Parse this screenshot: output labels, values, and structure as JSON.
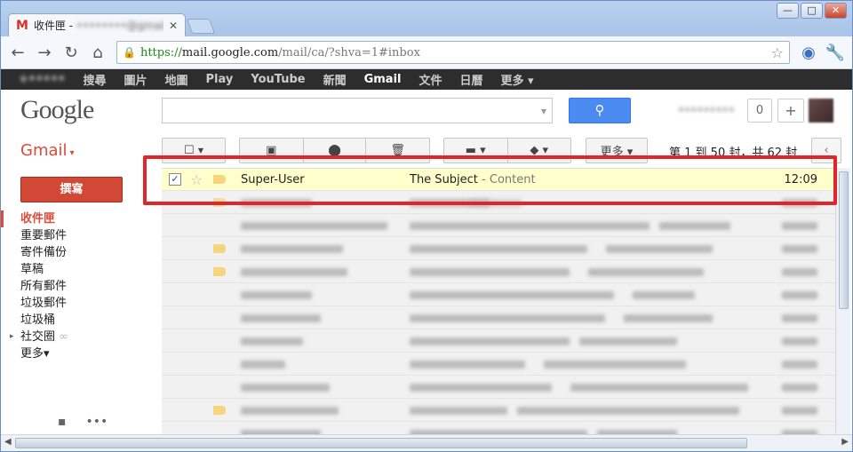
{
  "browser": {
    "tab_title": "收件匣",
    "tab_account": "••••••••@gmail.com",
    "tab_close": "✕",
    "window_buttons": [
      "—",
      "□",
      "✕"
    ],
    "url_scheme": "https://",
    "url_host": "mail.google.com",
    "url_path": "/mail/ca/?shva=1#inbox"
  },
  "gbar": {
    "items": [
      "+•••••",
      "搜尋",
      "圖片",
      "地圖",
      "Play",
      "YouTube",
      "新聞",
      "Gmail",
      "文件",
      "日曆",
      "更多 ▾"
    ]
  },
  "header": {
    "logo": "Google",
    "user_name": "•••••••••",
    "notif_count": "0",
    "plus": "+"
  },
  "gmail": {
    "label": "Gmail",
    "caret": "▾",
    "more_label": "更多 ▾",
    "pager": "第 1 到 50 封，共 62 封"
  },
  "sidebar": {
    "compose": "撰寫",
    "items": [
      "收件匣",
      "重要郵件",
      "寄件備份",
      "草稿",
      "所有郵件",
      "垃圾郵件",
      "垃圾桶",
      "社交圈",
      "更多▾"
    ]
  },
  "messages": {
    "selected": {
      "sender": "Super-User",
      "subject": "The Subject",
      "snippet": " - Content",
      "time": "12:09"
    }
  },
  "colors": {
    "accent_red": "#dd4b39",
    "search_blue": "#4b8af0",
    "highlight": "#e0262b",
    "selected_row": "#ffffcc"
  }
}
